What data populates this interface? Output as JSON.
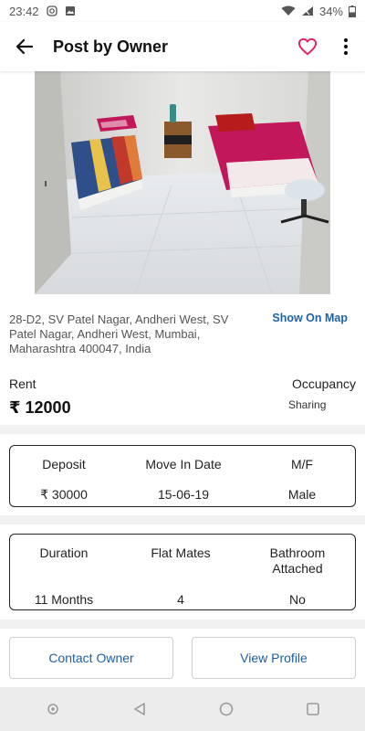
{
  "status_bar": {
    "time": "23:42",
    "battery": "34%"
  },
  "app_bar": {
    "title": "Post by Owner"
  },
  "listing": {
    "address": "28-D2, SV Patel Nagar, Andheri West, SV Patel Nagar, Andheri West, Mumbai, Maharashtra 400047, India",
    "show_map_label": "Show On Map",
    "rent_label": "Rent",
    "rent_value": "₹ 12000",
    "occupancy_label": "Occupancy",
    "occupancy_value": "Sharing"
  },
  "details_1": {
    "deposit_label": "Deposit",
    "deposit_value": "₹ 30000",
    "move_in_label": "Move In Date",
    "move_in_value": "15-06-19",
    "mf_label": "M/F",
    "mf_value": "Male"
  },
  "details_2": {
    "duration_label": "Duration",
    "duration_value": "11 Months",
    "flatmates_label": "Flat Mates",
    "flatmates_value": "4",
    "bathroom_label": "Bathroom Attached",
    "bathroom_value": "No"
  },
  "actions": {
    "contact_owner": "Contact Owner",
    "view_profile": "View Profile"
  },
  "colors": {
    "accent": "#1f63a6",
    "heart": "#e0245e"
  },
  "icons": [
    "back-arrow-icon",
    "heart-icon",
    "more-vert-icon",
    "back-nav-icon",
    "home-nav-icon",
    "recents-nav-icon"
  ]
}
